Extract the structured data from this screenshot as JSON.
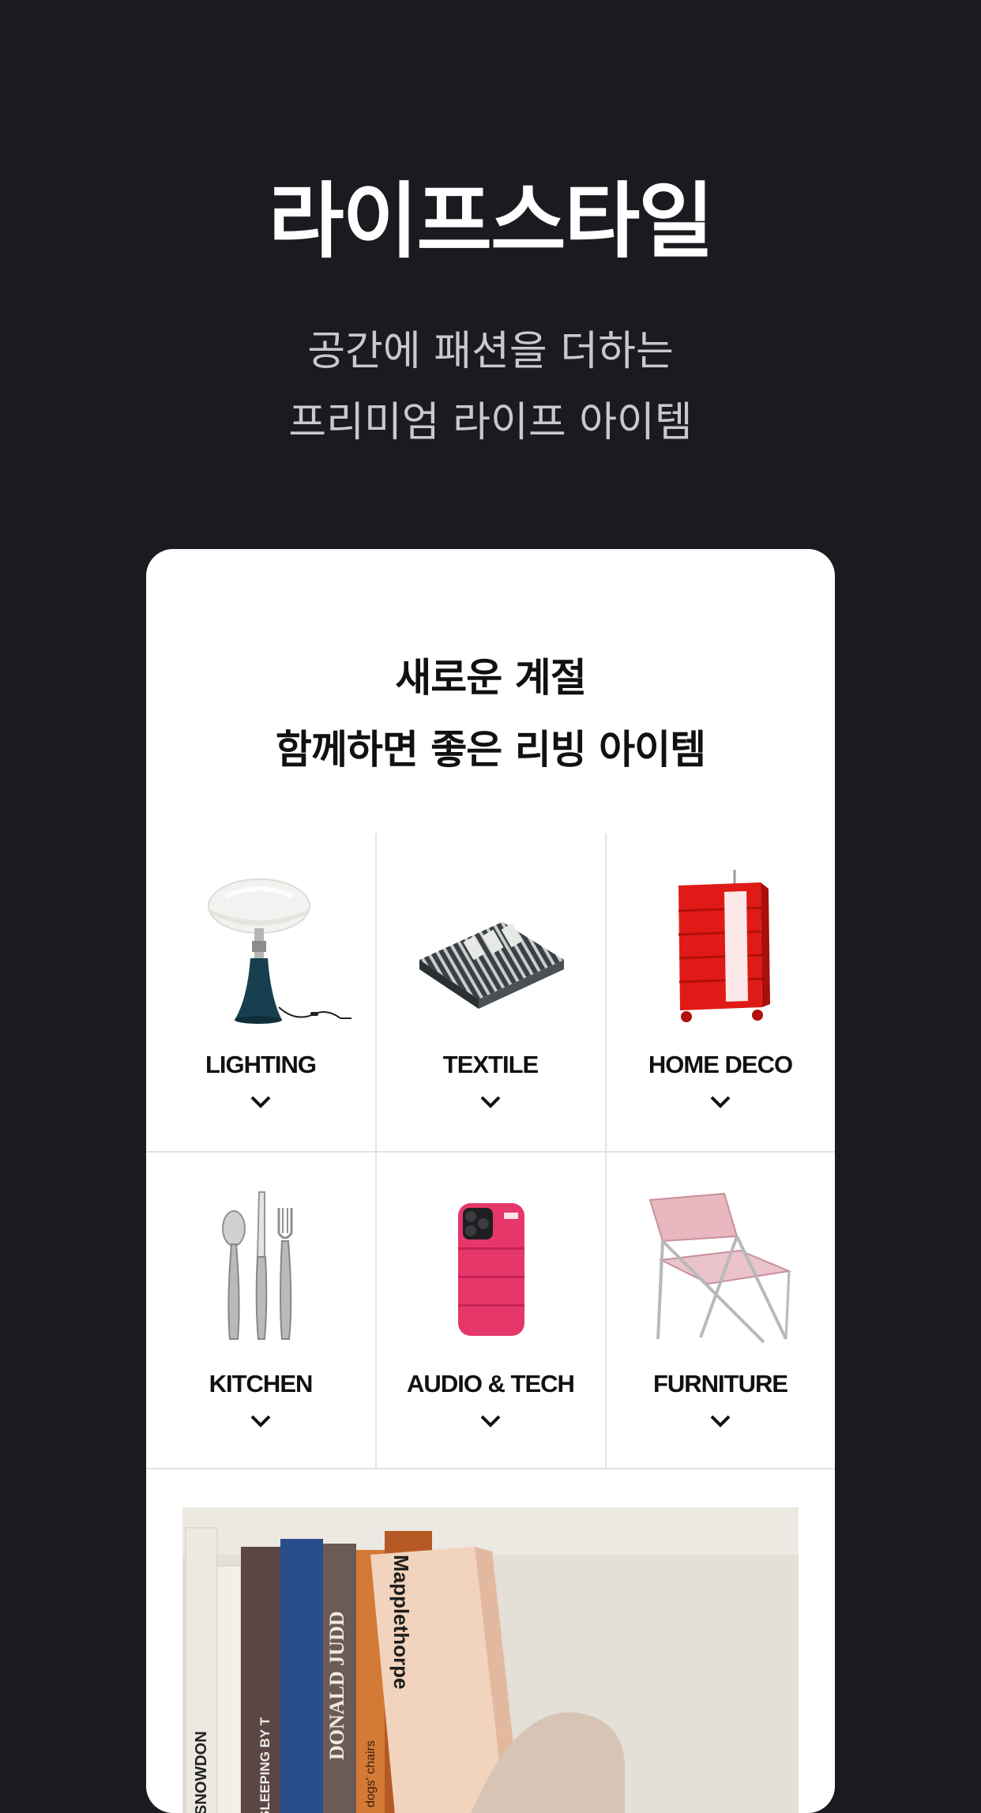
{
  "hero": {
    "title": "라이프스타일",
    "subtitle_line1": "공간에 패션을 더하는",
    "subtitle_line2": "프리미엄 라이프 아이템"
  },
  "card": {
    "heading_line1": "새로운 계절",
    "heading_line2": "함께하면 좋은 리빙 아이템"
  },
  "categories": [
    {
      "label": "LIGHTING",
      "icon": "table-lamp-icon"
    },
    {
      "label": "TEXTILE",
      "icon": "striped-blanket-icon"
    },
    {
      "label": "HOME DECO",
      "icon": "red-drawer-cart-icon"
    },
    {
      "label": "KITCHEN",
      "icon": "cutlery-set-icon"
    },
    {
      "label": "AUDIO & TECH",
      "icon": "pink-phone-case-icon"
    },
    {
      "label": "FURNITURE",
      "icon": "pink-folding-chair-icon"
    }
  ],
  "banner": {
    "book_titles": [
      "SNOWDON",
      "SLEEPING BY T",
      "DONALD JUDD",
      "dogs' chairs",
      "Mapplethorpe"
    ]
  },
  "colors": {
    "background": "#1b1a20",
    "card": "#ffffff",
    "divider": "#e3e3e3",
    "text_dark": "#111111"
  }
}
